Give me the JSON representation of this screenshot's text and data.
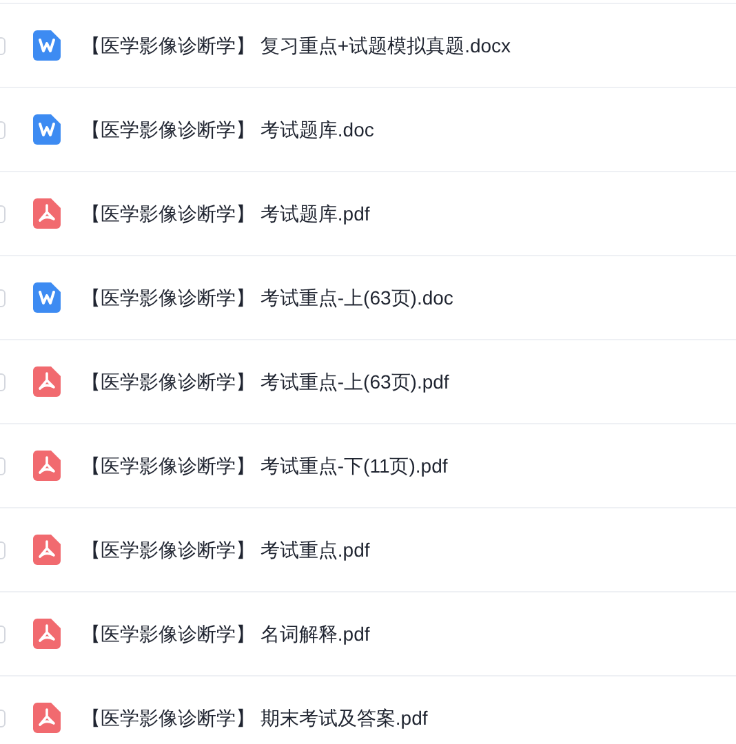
{
  "files": [
    {
      "kind": "word",
      "name": "【医学影像诊断学】 复习重点+试题模拟真题.docx",
      "checked": false
    },
    {
      "kind": "word",
      "name": "【医学影像诊断学】 考试题库.doc",
      "checked": false
    },
    {
      "kind": "pdf",
      "name": "【医学影像诊断学】 考试题库.pdf",
      "checked": false
    },
    {
      "kind": "word",
      "name": "【医学影像诊断学】 考试重点-上(63页).doc",
      "checked": false
    },
    {
      "kind": "pdf",
      "name": "【医学影像诊断学】 考试重点-上(63页).pdf",
      "checked": false
    },
    {
      "kind": "pdf",
      "name": "【医学影像诊断学】 考试重点-下(11页).pdf",
      "checked": false
    },
    {
      "kind": "pdf",
      "name": "【医学影像诊断学】 考试重点.pdf",
      "checked": false
    },
    {
      "kind": "pdf",
      "name": "【医学影像诊断学】 名词解释.pdf",
      "checked": false
    },
    {
      "kind": "pdf",
      "name": "【医学影像诊断学】 期末考试及答案.pdf",
      "checked": false
    }
  ]
}
